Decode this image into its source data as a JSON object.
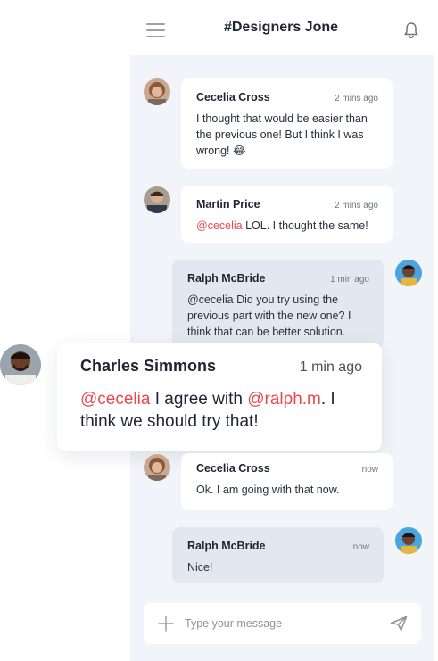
{
  "header": {
    "title": "#Designers Jone",
    "menu_icon": "hamburger-menu-icon",
    "notification_icon": "bell-icon"
  },
  "messages": [
    {
      "author": "Cecelia Cross",
      "time": "2 mins ago",
      "text": "I thought that would be easier than the previous one! But I think I was wrong! 😂",
      "mine": false
    },
    {
      "author": "Martin Price",
      "time": "2 mins ago",
      "mention": "@cecelia",
      "text": " LOL. I thought the same!",
      "mine": false
    },
    {
      "author": "Ralph McBride",
      "time": "1 min ago",
      "text": "@cecelia Did you try using the previous part with the new one? I think that can be better solution.",
      "mine": true
    },
    {
      "author": "Charles Simmons",
      "time": "1 min ago",
      "mention1": "@cecelia",
      "text1": " I agree with ",
      "mention2": "@ralph.m",
      "text2": ". I think we should try that!",
      "mine": false
    },
    {
      "author": "Cecelia Cross",
      "time": "now",
      "text": "Ok. I am going with that now.",
      "mine": false
    },
    {
      "author": "Ralph McBride",
      "time": "now",
      "text": "Nice!",
      "mine": true
    }
  ],
  "composer": {
    "placeholder": "Type your message",
    "value": "",
    "add_icon": "plus-icon",
    "send_icon": "send-icon"
  },
  "colors": {
    "accent_mention": "#e8494f",
    "panel_bg": "#f1f4f8",
    "own_bubble_bg": "#e3e8f0"
  }
}
